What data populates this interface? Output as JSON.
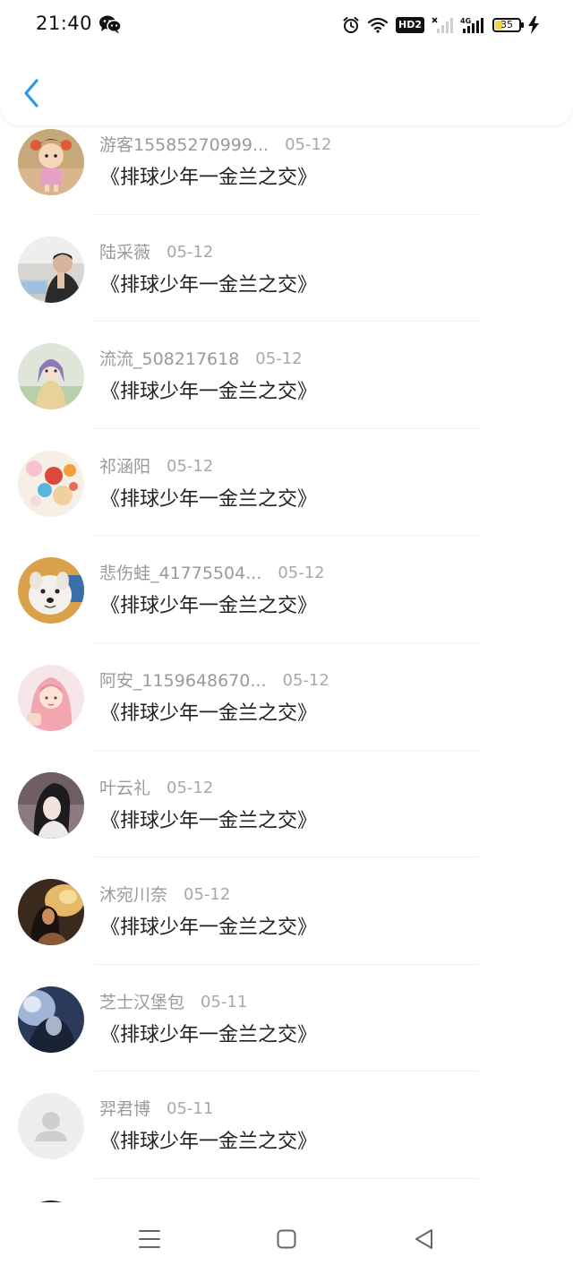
{
  "status_bar": {
    "time": "21:40",
    "battery_text": "35",
    "network_label": "4G",
    "hd_label": "HD2"
  },
  "header": {
    "back_icon": "chevron-left-icon"
  },
  "list": {
    "items": [
      {
        "name": "游客15585270999...",
        "date": "05-12",
        "title": "《排球少年一金兰之交》",
        "avatar": "cartoon-girl"
      },
      {
        "name": "陆采薇",
        "date": "05-12",
        "title": "《排球少年一金兰之交》",
        "avatar": "man-at-laptop"
      },
      {
        "name": "流流_508217618",
        "date": "05-12",
        "title": "《排球少年一金兰之交》",
        "avatar": "anime-character"
      },
      {
        "name": "祁涵阳",
        "date": "05-12",
        "title": "《排球少年一金兰之交》",
        "avatar": "colorful-balls"
      },
      {
        "name": "悲伤蛙_41775504...",
        "date": "05-12",
        "title": "《排球少年一金兰之交》",
        "avatar": "white-dog"
      },
      {
        "name": "阿安_1159648670...",
        "date": "05-12",
        "title": "《排球少年一金兰之交》",
        "avatar": "pink-hair-girl"
      },
      {
        "name": "叶云礼",
        "date": "05-12",
        "title": "《排球少年一金兰之交》",
        "avatar": "dark-hair-girl"
      },
      {
        "name": "沐宛川奈",
        "date": "05-12",
        "title": "《排球少年一金兰之交》",
        "avatar": "sunset-portrait"
      },
      {
        "name": "芝士汉堡包",
        "date": "05-11",
        "title": "《排球少年一金兰之交》",
        "avatar": "blue-portrait"
      },
      {
        "name": "羿君博",
        "date": "05-11",
        "title": "《排球少年一金兰之交》",
        "avatar": "default-user"
      }
    ]
  },
  "nav_bar": {
    "icons": [
      "menu-icon",
      "home-square-icon",
      "back-triangle-icon"
    ]
  }
}
